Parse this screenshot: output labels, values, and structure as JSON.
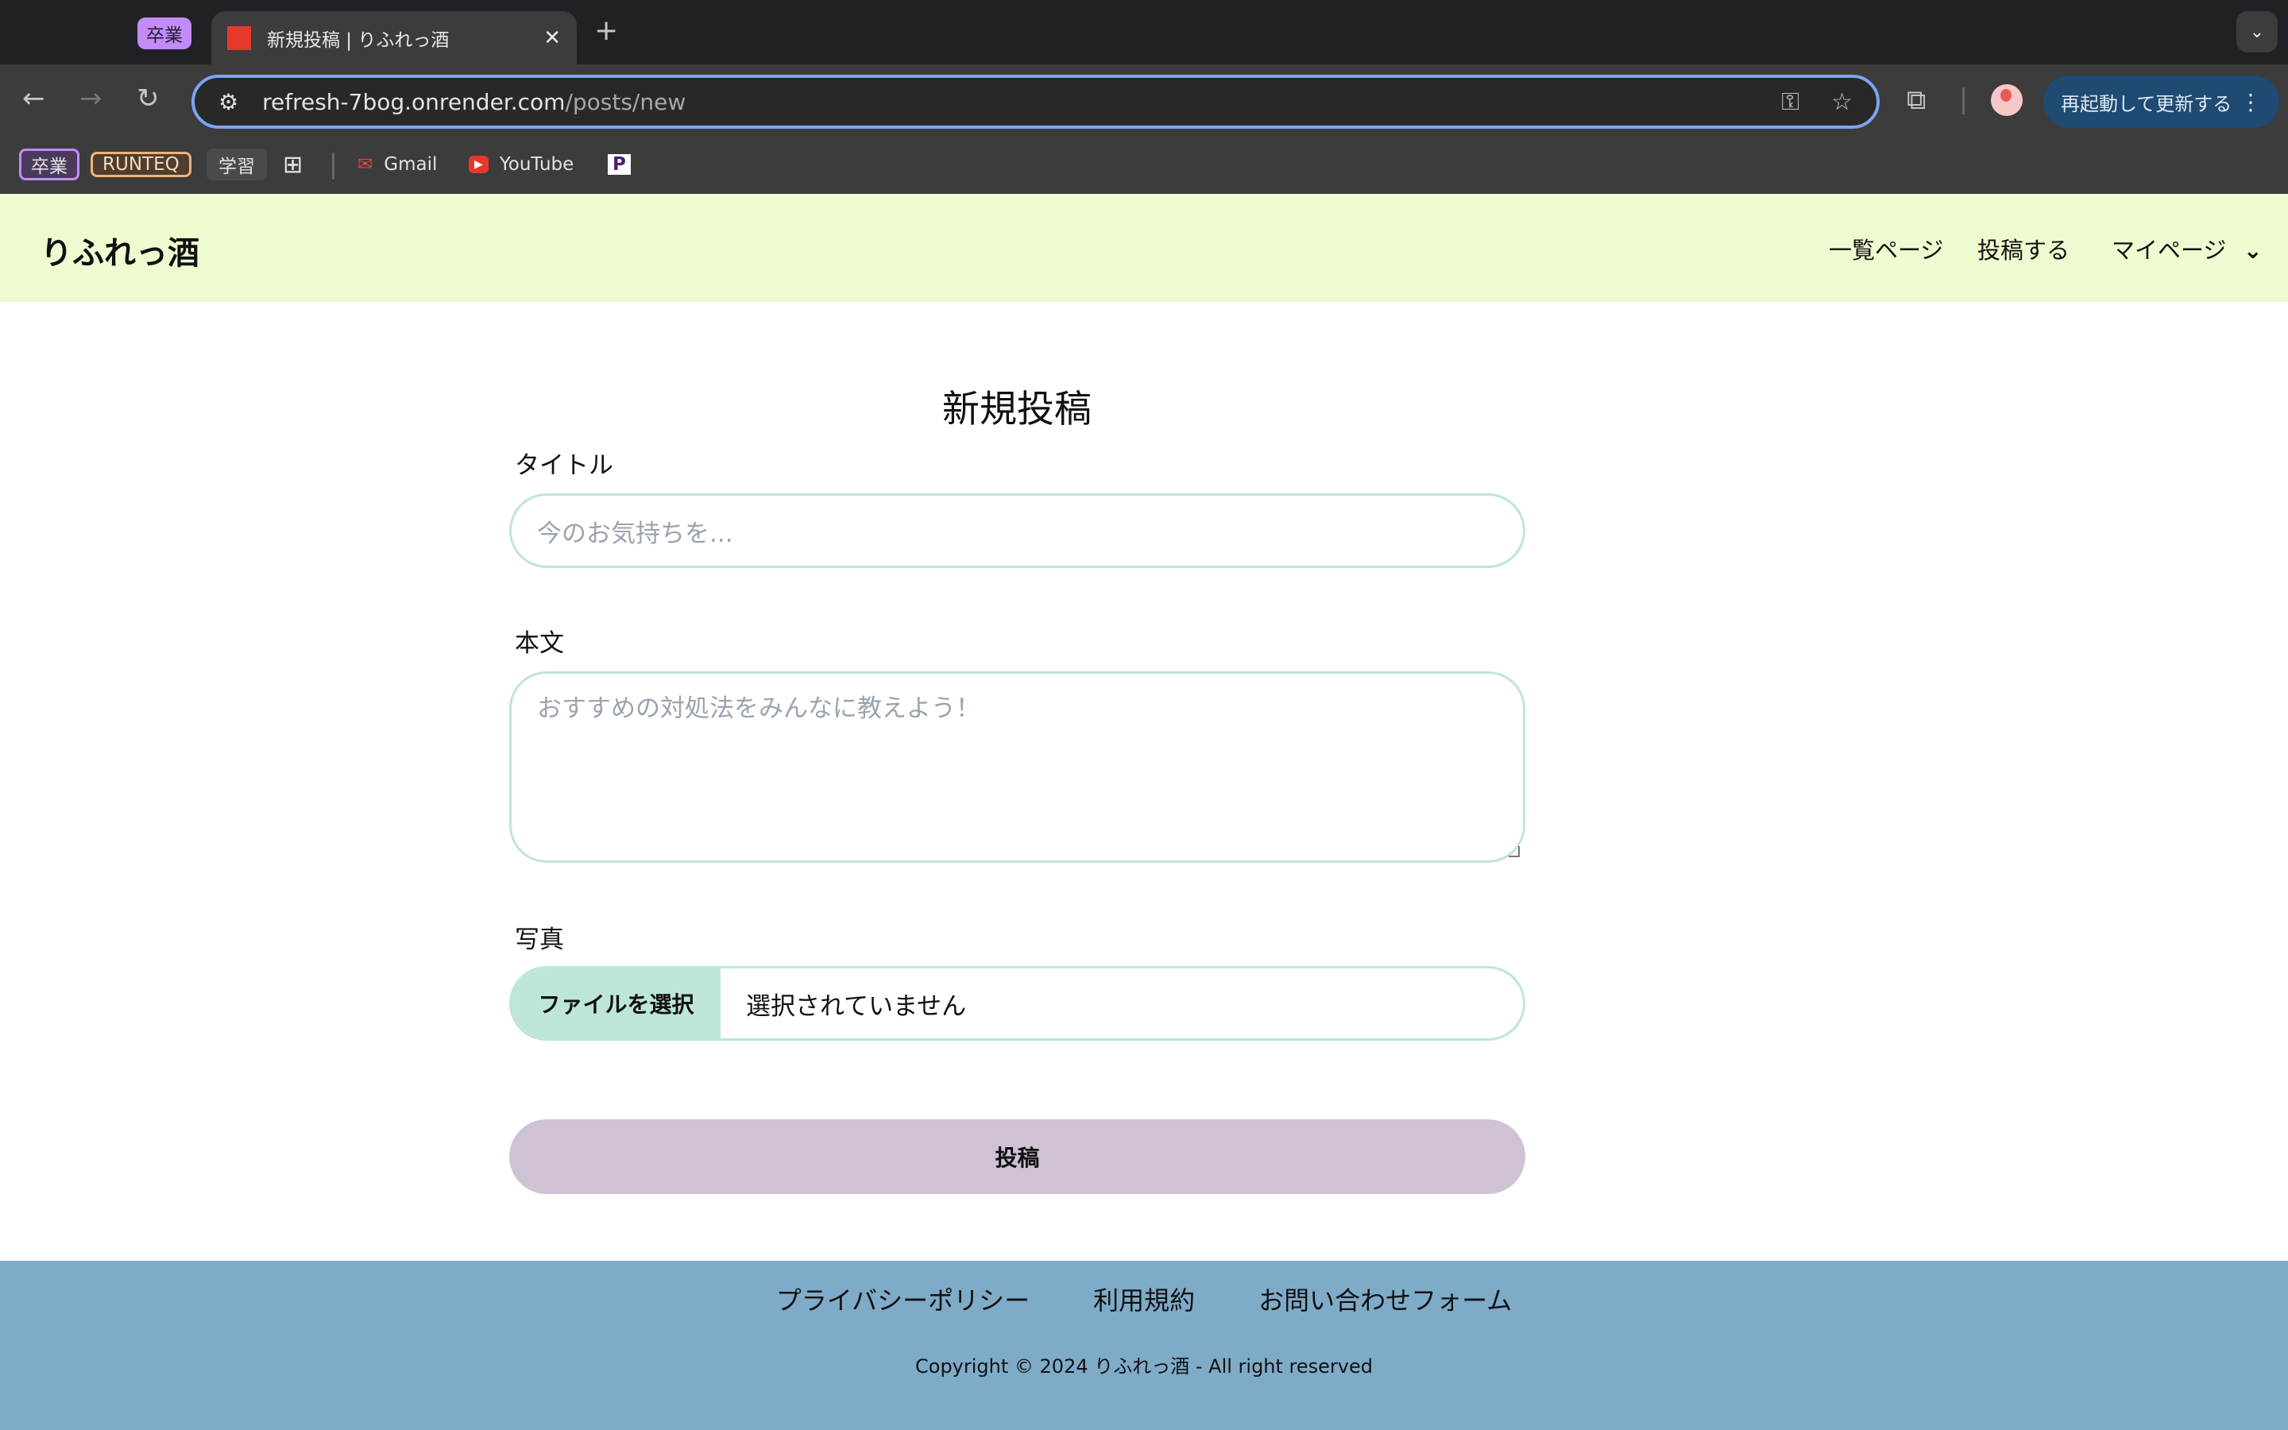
{
  "browser": {
    "tab_group": "卒業",
    "tab_title": "新規投稿 | りふれっ酒",
    "url_host": "refresh-7bog.onrender.com",
    "url_path": "/posts/new",
    "relaunch_label": "再起動して更新する",
    "bookmarks": [
      "卒業",
      "RUNTEQ",
      "学習",
      "Gmail",
      "YouTube"
    ],
    "colors": {
      "omnibox_border": "#7ca4f4",
      "relaunch": "#1f4a72"
    }
  },
  "header": {
    "logo": "りふれっ酒",
    "nav": [
      "一覧ページ",
      "投稿する",
      "マイページ"
    ],
    "bg": "#eefbd0"
  },
  "form": {
    "heading": "新規投稿",
    "title_label": "タイトル",
    "title_placeholder": "今のお気持ちを...",
    "body_label": "本文",
    "body_placeholder": "おすすめの対処法をみんなに教えよう！",
    "photo_label": "写真",
    "file_button": "ファイルを選択",
    "file_status": "選択されていません",
    "submit": "投稿",
    "colors": {
      "border": "#bde6d8",
      "submit": "#cfc2d5"
    }
  },
  "footer": {
    "links": [
      "プライバシーポリシー",
      "利用規約",
      "お問い合わせフォーム"
    ],
    "copyright": "Copyright © 2024 りふれっ酒 - All right reserved",
    "bg": "#7eabc8"
  }
}
